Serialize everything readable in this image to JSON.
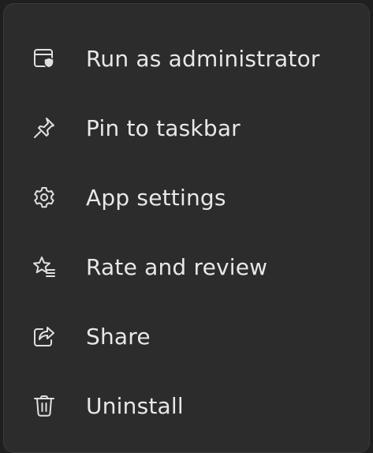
{
  "menu": {
    "items": [
      {
        "label": "Run as administrator",
        "icon": "admin-shield-icon"
      },
      {
        "label": "Pin to taskbar",
        "icon": "pin-icon"
      },
      {
        "label": "App settings",
        "icon": "gear-icon"
      },
      {
        "label": "Rate and review",
        "icon": "star-review-icon"
      },
      {
        "label": "Share",
        "icon": "share-icon"
      },
      {
        "label": "Uninstall",
        "icon": "trash-icon"
      }
    ]
  },
  "colors": {
    "background": "#2c2c2c",
    "text": "#e8e8e8",
    "icon": "#e0e0e0"
  }
}
